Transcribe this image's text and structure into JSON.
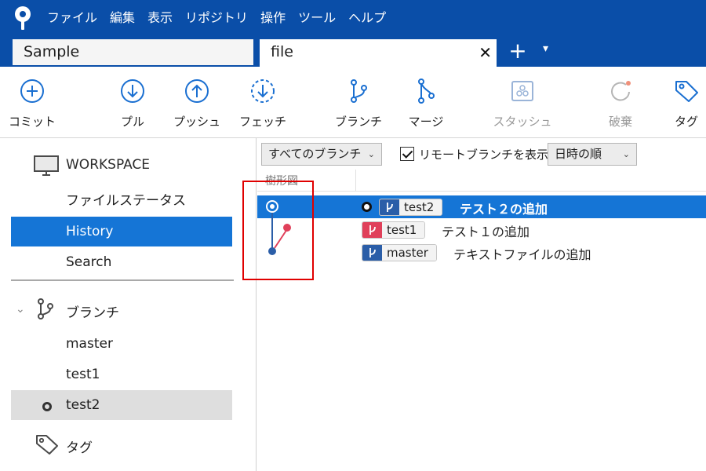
{
  "menu": [
    "ファイル",
    "編集",
    "表示",
    "リポジトリ",
    "操作",
    "ツール",
    "ヘルプ"
  ],
  "tabs": [
    {
      "label": "Sample",
      "active": false
    },
    {
      "label": "file",
      "active": true,
      "close": "✕"
    }
  ],
  "new_tab": "+",
  "tab_menu": "▾",
  "toolbar": [
    {
      "label": "コミット",
      "icon": "plus-circle-icon",
      "enabled": true
    },
    {
      "label": "プル",
      "icon": "arrow-down-circle-icon",
      "enabled": true
    },
    {
      "label": "プッシュ",
      "icon": "arrow-up-circle-icon",
      "enabled": true
    },
    {
      "label": "フェッチ",
      "icon": "dashed-arrow-down-circle-icon",
      "enabled": true
    },
    {
      "label": "ブランチ",
      "icon": "branch-icon",
      "enabled": true
    },
    {
      "label": "マージ",
      "icon": "merge-icon",
      "enabled": true
    },
    {
      "label": "スタッシュ",
      "icon": "stash-icon",
      "enabled": false
    },
    {
      "label": "破棄",
      "icon": "discard-icon",
      "enabled": false
    },
    {
      "label": "タグ",
      "icon": "tag-icon",
      "enabled": true
    }
  ],
  "sidebar": {
    "workspace": {
      "label": "WORKSPACE",
      "items": [
        {
          "label": "ファイルステータス",
          "selected": false
        },
        {
          "label": "History",
          "selected": true
        },
        {
          "label": "Search",
          "selected": false
        }
      ]
    },
    "branches": {
      "label": "ブランチ",
      "items": [
        {
          "label": "master",
          "current": false
        },
        {
          "label": "test1",
          "current": false
        },
        {
          "label": "test2",
          "current": true
        }
      ]
    },
    "tags": {
      "label": "タグ"
    }
  },
  "filters": {
    "branches_dropdown": "すべてのブランチ",
    "show_remote_label": "リモートブランチを表示",
    "show_remote_checked": true,
    "order_dropdown": "日時の順",
    "caret": "⌄"
  },
  "history": {
    "column_graph": "樹形図",
    "commits": [
      {
        "branch": "test2",
        "message": "テスト２の追加",
        "selected": true,
        "head": true,
        "badge_color": "#2b5ea8"
      },
      {
        "branch": "test1",
        "message": "テスト１の追加",
        "selected": false,
        "head": false,
        "badge_color": "#e0405a"
      },
      {
        "branch": "master",
        "message": "テキストファイルの追加",
        "selected": false,
        "head": false,
        "badge_color": "#2b5ea8"
      }
    ]
  },
  "colors": {
    "title_bar": "#0a4ea8",
    "selection": "#1575d6",
    "accent_blue": "#2b5ea8",
    "accent_red": "#e0405a",
    "highlight_box": "#e00000"
  }
}
